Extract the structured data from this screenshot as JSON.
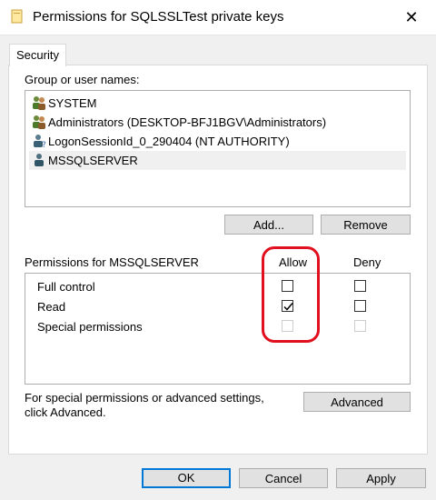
{
  "window": {
    "title": "Permissions for SQLSSLTest private keys"
  },
  "tabs": [
    {
      "label": "Security"
    }
  ],
  "group_label": "Group or user names:",
  "users": [
    {
      "name": "SYSTEM",
      "icon": "users-group-icon"
    },
    {
      "name": "Administrators (DESKTOP-BFJ1BGV\\Administrators)",
      "icon": "users-group-icon"
    },
    {
      "name": "LogonSessionId_0_290404 (NT AUTHORITY)",
      "icon": "unknown-user-icon"
    },
    {
      "name": "MSSQLSERVER",
      "icon": "user-icon",
      "selected": true
    }
  ],
  "buttons": {
    "add": "Add...",
    "remove": "Remove",
    "advanced": "Advanced",
    "ok": "OK",
    "cancel": "Cancel",
    "apply": "Apply"
  },
  "permissions": {
    "header": "Permissions for MSSQLSERVER",
    "allow": "Allow",
    "deny": "Deny",
    "rows": [
      {
        "name": "Full control",
        "allow": false,
        "deny": false
      },
      {
        "name": "Read",
        "allow": true,
        "deny": false
      },
      {
        "name": "Special permissions",
        "allow": false,
        "deny": false,
        "disabled": true
      }
    ]
  },
  "advanced_text": {
    "line1": "For special permissions or advanced settings,",
    "line2": "click Advanced."
  },
  "colors": {
    "highlight": "#e0101e",
    "focus": "#0078d7"
  }
}
